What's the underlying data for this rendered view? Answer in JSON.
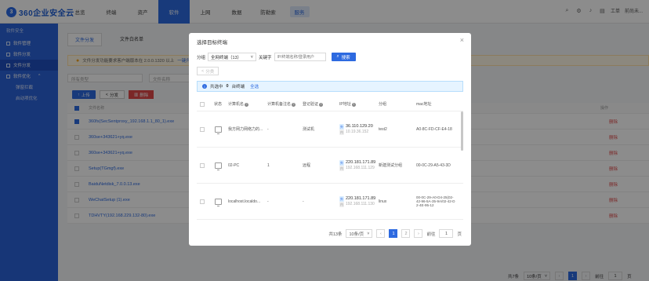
{
  "app": {
    "logo_text": "360企业安全云",
    "logo_mark": "3"
  },
  "nav": {
    "items": [
      "总览",
      "终端",
      "资产",
      "软件",
      "上网",
      "数据",
      "防勒索"
    ],
    "service": "服务",
    "active": "软件",
    "right": {
      "user": "工单",
      "account": "前尚未..."
    }
  },
  "sidebar": {
    "section": "软件安全",
    "items": [
      {
        "label": "软件管理"
      },
      {
        "label": "软件分发"
      },
      {
        "label": "文件分发",
        "active": true
      },
      {
        "label": "软件优化"
      }
    ],
    "subitems": [
      "弹窗拦截",
      "启动项优化"
    ]
  },
  "background": {
    "tabs": [
      "文件分发",
      "文件白名单"
    ],
    "notice": "文件分发功能要求客户端版本在 2.0.0.1320 以上",
    "notice_link": "一键升级",
    "filter_type": "所有类型",
    "filter_name": "文件名称",
    "upload": "上传",
    "distribute": "分发",
    "delete": "删除",
    "col_name": "文件名称",
    "col_action": "操作",
    "files": [
      {
        "name": "360fs(SecSentproxy_192.168.1.1_80_1).exe",
        "checked": true
      },
      {
        "name": "360se+343621+yq.exe",
        "checked": false
      },
      {
        "name": "360se+343621+yq.exe",
        "checked": false
      },
      {
        "name": "Setup(TGmgf).exe",
        "checked": false
      },
      {
        "name": "BaiduNetdisk_7.0.0.13.exe",
        "checked": false
      },
      {
        "name": "WeChatSetup (1).exe",
        "checked": false
      },
      {
        "name": "TDHVTY(192.168.229.132-80).exe",
        "checked": false
      }
    ],
    "delete_link": "删除",
    "pager": {
      "total": "共7条",
      "size": "10条/页",
      "page": "1",
      "goto": "前往",
      "goto_val": "1",
      "page_suffix": "页"
    }
  },
  "modal": {
    "title": "选择目标终端",
    "group_label": "分组",
    "group_value": "全网终端（13）",
    "keyword_label": "关键字",
    "keyword_placeholder": "IP/终端名称/登录用户",
    "search_btn": "搜索",
    "group_btn": "分类",
    "info_prefix": "共选中",
    "info_count": "0",
    "info_suffix": "台终端",
    "select_all": "全选",
    "columns": [
      "状态",
      "计算机名",
      "计算机备注名",
      "登记验证",
      "IP地址",
      "分组",
      "mac地址"
    ],
    "rows": [
      {
        "name": "我方网力网络力的...",
        "note": "-",
        "auth": "测试机",
        "ip_out": "36.110.129.20",
        "ip_in": "10.19.36.152",
        "group": "test2",
        "mac": "A0-8C-FD-CF-E4-18"
      },
      {
        "name": "02-PC",
        "note": "1",
        "auth": "远程",
        "ip_out": "220.181.171.89",
        "ip_in": "192.168.111.129",
        "group": "新建测试分组",
        "mac": "00-0C-29-A5-43-3D"
      },
      {
        "name": "localhost.localdo...",
        "note": "-",
        "auth": "-",
        "ip_out": "220.181.171.89",
        "ip_in": "192.168.111.130",
        "group": "linux",
        "mac": "00-0C-29-A0-D4-25(02-42-96-5A-35-9A/02-42-D2-4E-95-12"
      }
    ],
    "tag_out": "外",
    "tag_in": "内",
    "pager": {
      "total": "共13条",
      "size": "10条/页",
      "pages": [
        "1",
        "2"
      ],
      "goto": "前往",
      "goto_val": "1",
      "page_suffix": "页"
    }
  }
}
